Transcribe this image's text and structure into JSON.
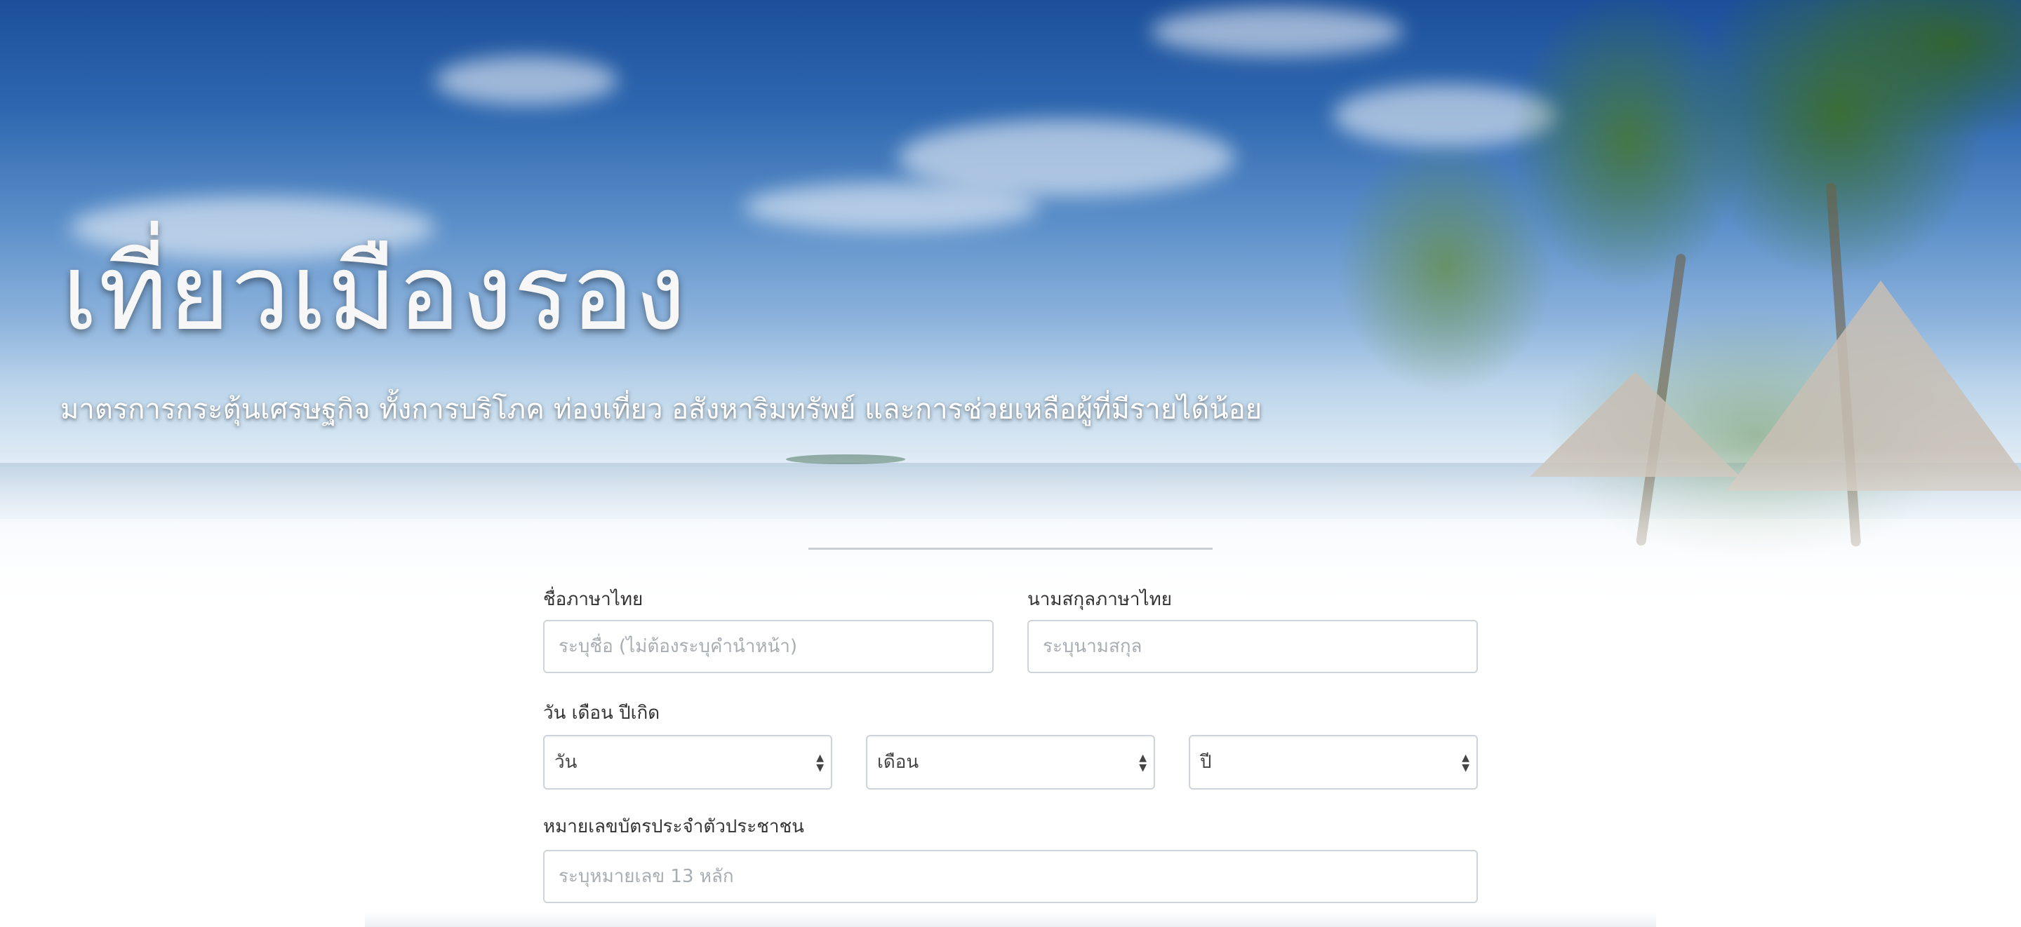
{
  "hero": {
    "title": "เที่ยวเมืองรอง",
    "subtitle": "มาตรการกระตุ้นเศรษฐกิจ ทั้งการบริโภค ท่องเที่ยว อสังหาริมทรัพย์ และการช่วยเหลือผู้ที่มีรายได้น้อย"
  },
  "form": {
    "first_name": {
      "label": "ชื่อภาษาไทย",
      "placeholder": "ระบุชื่อ (ไม่ต้องระบุคำนำหน้า)"
    },
    "last_name": {
      "label": "นามสกุลภาษาไทย",
      "placeholder": "ระบุนามสกุล"
    },
    "birth_date": {
      "label": "วัน เดือน ปีเกิด",
      "day": "วัน",
      "month": "เดือน",
      "year": "ปี"
    },
    "id_card": {
      "label": "หมายเลขบัตรประจำตัวประชาชน",
      "placeholder": "ระบุหมายเลข 13 หลัก"
    }
  },
  "icons": {
    "select_arrow": "up-down-caret-icon"
  },
  "colors": {
    "sky_top": "#1b4f9a",
    "input_border": "#cfd4da",
    "label_text": "#333333",
    "placeholder_text": "#a8adb3"
  }
}
